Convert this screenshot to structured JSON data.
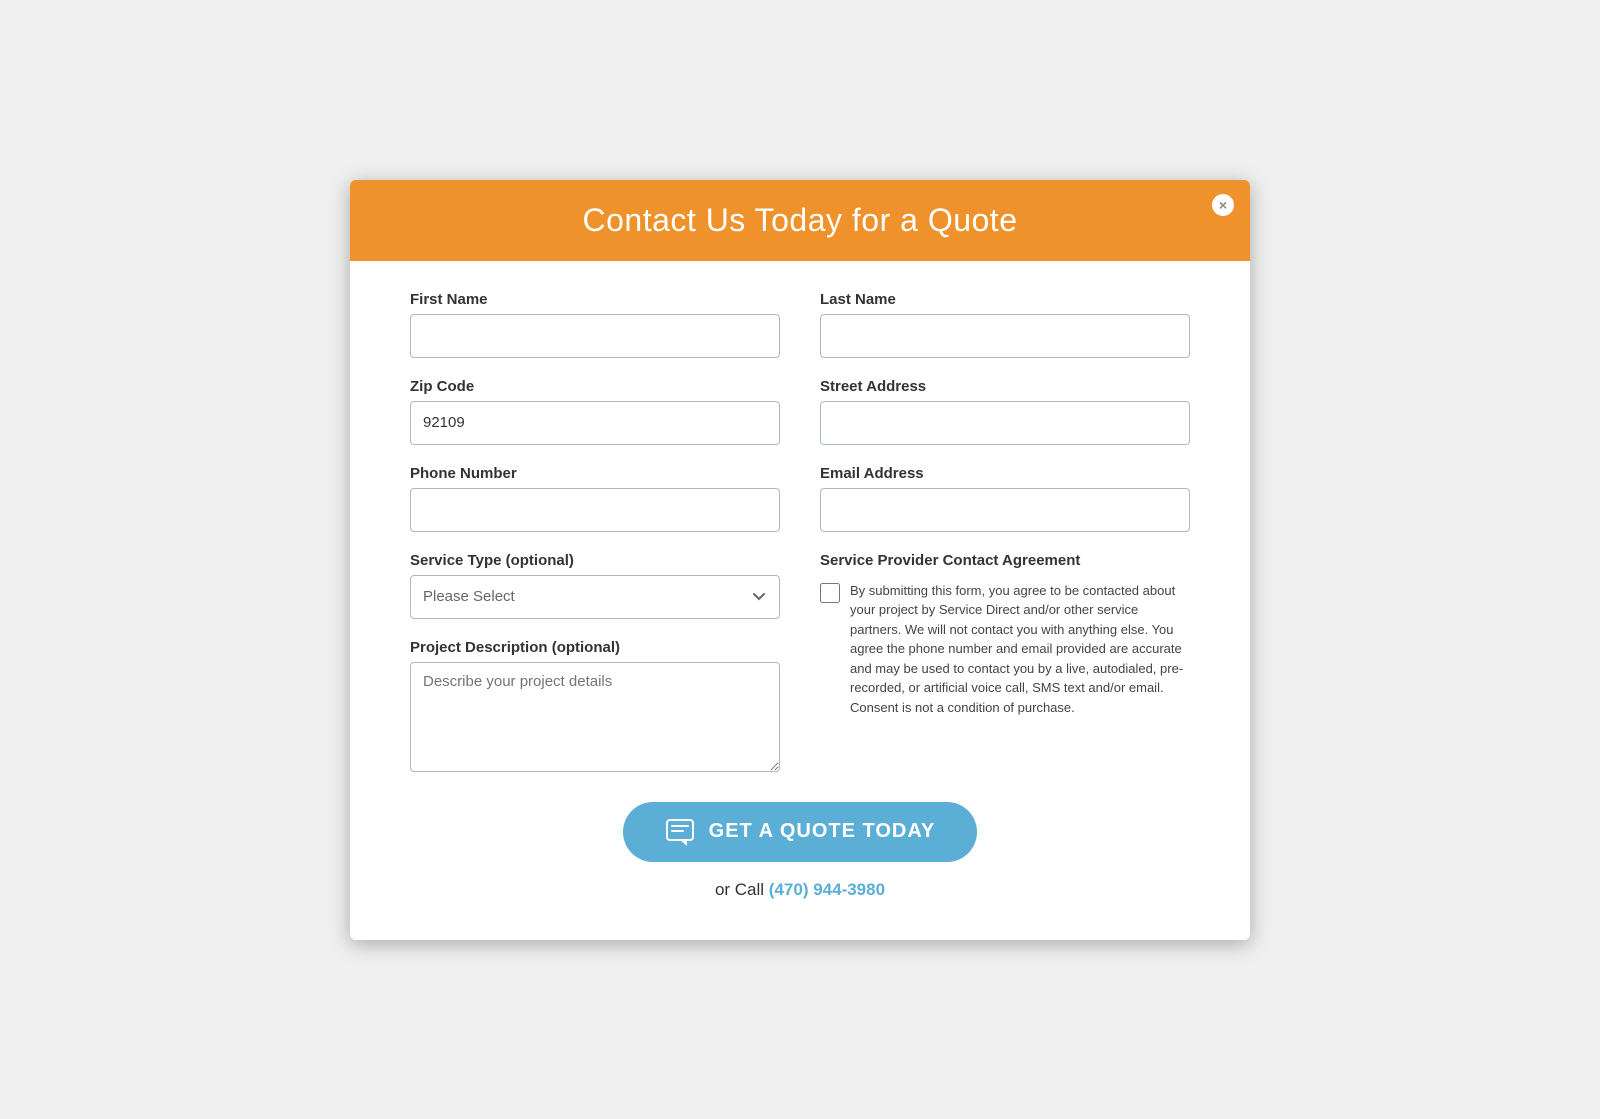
{
  "modal": {
    "title": "Contact Us Today for a Quote",
    "close_button_label": "×"
  },
  "form": {
    "first_name": {
      "label": "First Name",
      "value": "",
      "placeholder": ""
    },
    "last_name": {
      "label": "Last Name",
      "value": "",
      "placeholder": ""
    },
    "zip_code": {
      "label": "Zip Code",
      "value": "92109",
      "placeholder": ""
    },
    "street_address": {
      "label": "Street Address",
      "value": "",
      "placeholder": ""
    },
    "phone_number": {
      "label": "Phone Number",
      "value": "",
      "placeholder": ""
    },
    "email_address": {
      "label": "Email Address",
      "value": "",
      "placeholder": ""
    },
    "service_type": {
      "label": "Service Type (optional)",
      "placeholder": "Please Select",
      "options": [
        "Please Select"
      ]
    },
    "project_description": {
      "label": "Project Description (optional)",
      "placeholder": "Describe your project details",
      "value": ""
    },
    "agreement": {
      "title": "Service Provider Contact Agreement",
      "text": "By submitting this form, you agree to be contacted about your project by Service Direct and/or other service partners. We will not contact you with anything else. You agree the phone number and email provided are accurate and may be used to contact you by a live, autodialed, pre-recorded, or artificial voice call, SMS text and/or email. Consent is not a condition of purchase.",
      "checked": false
    },
    "submit_button": "GET A QUOTE TODAY",
    "call_text": "or Call",
    "call_number": "(470) 944-3980",
    "call_href": "tel:4709443980"
  }
}
